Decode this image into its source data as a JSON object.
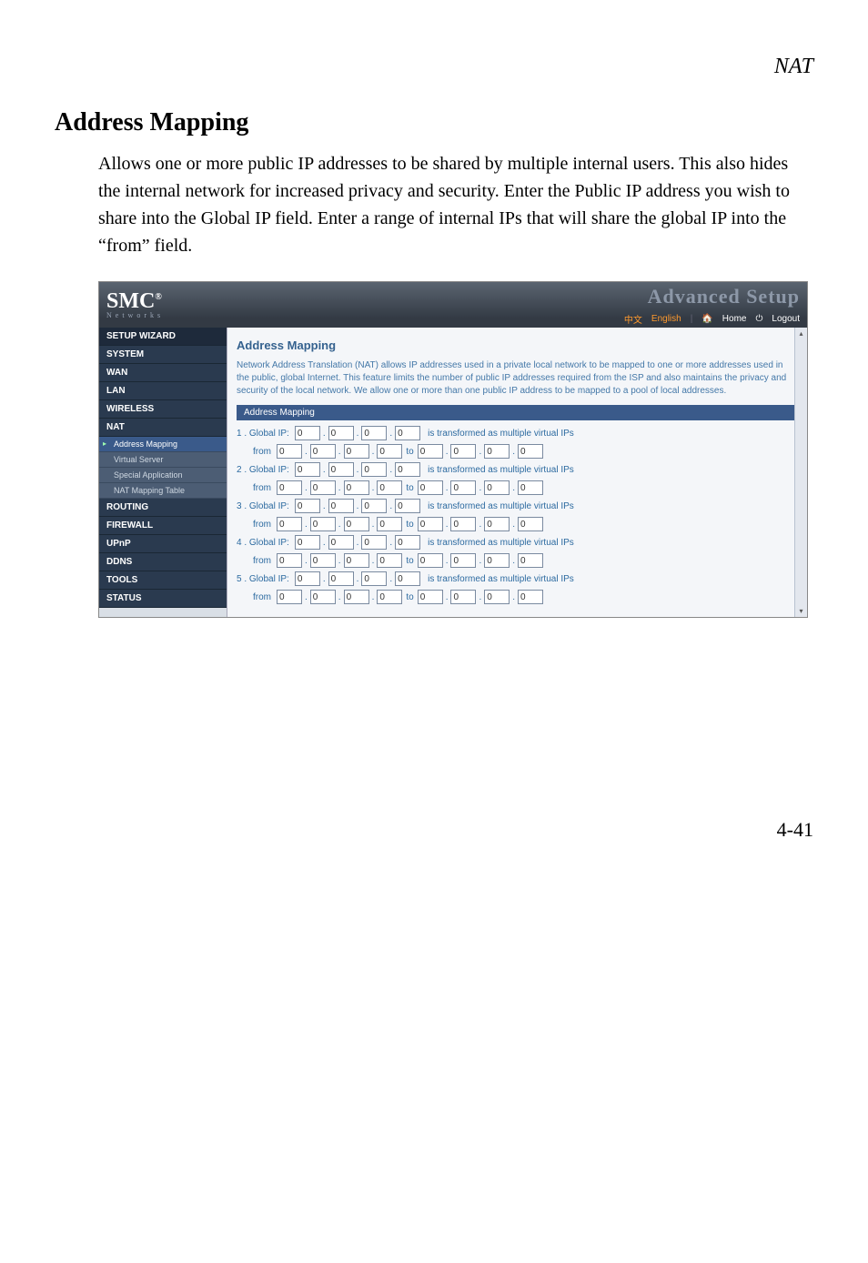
{
  "page_label": "NAT",
  "heading": "Address Mapping",
  "body_paragraph": "Allows one or more public IP addresses to be shared by multiple internal users. This also hides the internal network for increased privacy and security. Enter the Public IP address you wish to share into the Global IP field. Enter a range of internal IPs that will share the global IP into the “from” field.",
  "page_number": "4-41",
  "screenshot": {
    "logo": {
      "brand": "SMC",
      "reg": "®",
      "sub": "N e t w o r k s"
    },
    "banner_text": "Advanced Setup",
    "toplinks": {
      "lang1": "中文",
      "lang2": "English",
      "home": "Home",
      "logout": "Logout"
    },
    "sidebar": [
      {
        "label": "SETUP WIZARD",
        "type": "dark"
      },
      {
        "label": "SYSTEM",
        "type": "item"
      },
      {
        "label": "WAN",
        "type": "item"
      },
      {
        "label": "LAN",
        "type": "item"
      },
      {
        "label": "WIRELESS",
        "type": "item"
      },
      {
        "label": "NAT",
        "type": "item"
      },
      {
        "label": "Address Mapping",
        "type": "sub_active"
      },
      {
        "label": "Virtual Server",
        "type": "sub"
      },
      {
        "label": "Special Application",
        "type": "sub"
      },
      {
        "label": "NAT Mapping Table",
        "type": "sub"
      },
      {
        "label": "ROUTING",
        "type": "item"
      },
      {
        "label": "FIREWALL",
        "type": "item"
      },
      {
        "label": "UPnP",
        "type": "item"
      },
      {
        "label": "DDNS",
        "type": "item"
      },
      {
        "label": "TOOLS",
        "type": "item"
      },
      {
        "label": "STATUS",
        "type": "item"
      }
    ],
    "main": {
      "title": "Address Mapping",
      "description": "Network Address Translation (NAT) allows IP addresses used in a private local network to be mapped to one or more addresses used in the public, global Internet. This feature limits the number of public IP addresses required from the ISP and also maintains the privacy and security of the local network. We allow one or more than one public IP address to be mapped to a pool of local addresses.",
      "panel_title": "Address Mapping",
      "global_label_prefix": "Global IP:",
      "from_label": "from",
      "to_label": "to",
      "virtual_text": "is transformed as multiple virtual IPs",
      "entries": [
        {
          "n": "1 .",
          "gip": [
            "0",
            "0",
            "0",
            "0"
          ],
          "from": [
            "0",
            "0",
            "0",
            "0"
          ],
          "to_ip": [
            "0",
            "0",
            "0",
            "0"
          ]
        },
        {
          "n": "2 .",
          "gip": [
            "0",
            "0",
            "0",
            "0"
          ],
          "from": [
            "0",
            "0",
            "0",
            "0"
          ],
          "to_ip": [
            "0",
            "0",
            "0",
            "0"
          ]
        },
        {
          "n": "3 .",
          "gip": [
            "0",
            "0",
            "0",
            "0"
          ],
          "from": [
            "0",
            "0",
            "0",
            "0"
          ],
          "to_ip": [
            "0",
            "0",
            "0",
            "0"
          ]
        },
        {
          "n": "4 .",
          "gip": [
            "0",
            "0",
            "0",
            "0"
          ],
          "from": [
            "0",
            "0",
            "0",
            "0"
          ],
          "to_ip": [
            "0",
            "0",
            "0",
            "0"
          ]
        },
        {
          "n": "5 .",
          "gip": [
            "0",
            "0",
            "0",
            "0"
          ],
          "from": [
            "0",
            "0",
            "0",
            "0"
          ],
          "to_ip": [
            "0",
            "0",
            "0",
            "0"
          ]
        }
      ]
    }
  }
}
